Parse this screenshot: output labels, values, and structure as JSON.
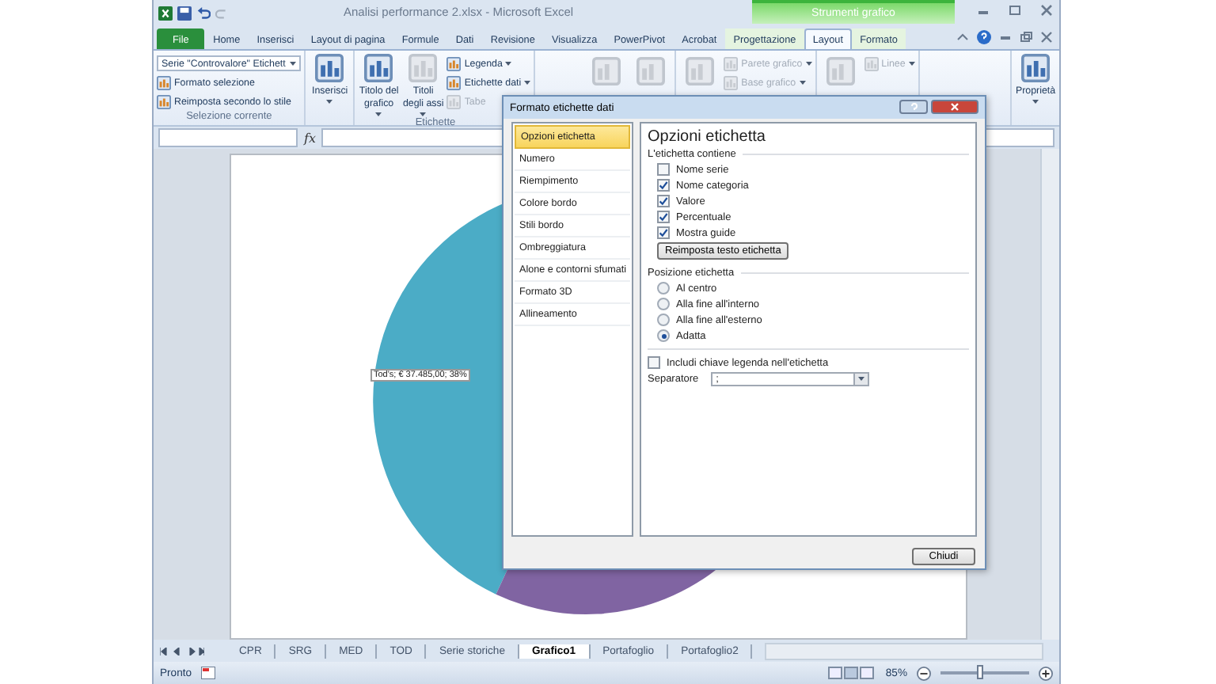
{
  "window": {
    "title": "Analisi performance 2.xlsx  -  Microsoft Excel",
    "context_group": "Strumenti grafico"
  },
  "ribbon_tabs": [
    {
      "label": "File",
      "kind": "file",
      "selected": false
    },
    {
      "label": "Home",
      "kind": "normal",
      "selected": false
    },
    {
      "label": "Inserisci",
      "kind": "normal",
      "selected": false
    },
    {
      "label": "Layout di pagina",
      "kind": "normal",
      "selected": false
    },
    {
      "label": "Formule",
      "kind": "normal",
      "selected": false
    },
    {
      "label": "Dati",
      "kind": "normal",
      "selected": false
    },
    {
      "label": "Revisione",
      "kind": "normal",
      "selected": false
    },
    {
      "label": "Visualizza",
      "kind": "normal",
      "selected": false
    },
    {
      "label": "PowerPivot",
      "kind": "normal",
      "selected": false
    },
    {
      "label": "Acrobat",
      "kind": "normal",
      "selected": false
    },
    {
      "label": "Progettazione",
      "kind": "context",
      "selected": false
    },
    {
      "label": "Layout",
      "kind": "context",
      "selected": true
    },
    {
      "label": "Formato",
      "kind": "context",
      "selected": false
    }
  ],
  "ribbon_groups": [
    {
      "label": "Selezione corrente",
      "items": [
        {
          "kind": "column",
          "items": [
            {
              "kind": "dropdown",
              "label": "Serie \"Controvalore\" Etichett"
            },
            {
              "kind": "small",
              "label": "Formato selezione",
              "disabled": false,
              "menu": false
            },
            {
              "kind": "small",
              "label": "Reimposta secondo lo stile",
              "disabled": false,
              "menu": false
            }
          ]
        }
      ]
    },
    {
      "items": [
        {
          "kind": "large",
          "label": "Inserisci",
          "disabled": false,
          "menu": true
        }
      ]
    },
    {
      "label": "Etichette",
      "items": [
        {
          "kind": "large",
          "label": "Titolo del grafico",
          "disabled": false,
          "menu": true
        },
        {
          "kind": "large",
          "label": "Titoli degli assi",
          "disabled": true,
          "menu": true
        },
        {
          "kind": "column",
          "items": [
            {
              "kind": "small",
              "label": "Legenda",
              "disabled": false,
              "menu": true
            },
            {
              "kind": "small",
              "label": "Etichette dati",
              "disabled": false,
              "menu": true
            },
            {
              "kind": "small",
              "label": "Tabe",
              "disabled": true,
              "menu": false
            }
          ]
        }
      ]
    },
    {
      "items": [
        {
          "kind": "icon",
          "disabled": true
        },
        {
          "kind": "icon",
          "disabled": true
        }
      ]
    },
    {
      "items": [
        {
          "kind": "icon",
          "disabled": true
        },
        {
          "kind": "column",
          "items": [
            {
              "kind": "small",
              "label": "Parete grafico",
              "disabled": true,
              "menu": true
            },
            {
              "kind": "small",
              "label": "Base grafico",
              "disabled": true,
              "menu": true
            }
          ]
        }
      ]
    },
    {
      "items": [
        {
          "kind": "icon",
          "disabled": true
        },
        {
          "kind": "column",
          "items": [
            {
              "kind": "small",
              "label": "Linee",
              "disabled": true,
              "menu": true
            }
          ]
        }
      ]
    },
    {
      "items": [
        {
          "kind": "large",
          "label": "Proprietà",
          "disabled": false,
          "menu": true
        }
      ]
    }
  ],
  "chart": {
    "data_label": "Tod's; € 37.485,00; 38%"
  },
  "dialog": {
    "title": "Formato etichette dati",
    "nav": [
      {
        "label": "Opzioni etichetta",
        "selected": true
      },
      {
        "label": "Numero",
        "selected": false
      },
      {
        "label": "Riempimento",
        "selected": false
      },
      {
        "label": "Colore bordo",
        "selected": false
      },
      {
        "label": "Stili bordo",
        "selected": false
      },
      {
        "label": "Ombreggiatura",
        "selected": false
      },
      {
        "label": "Alone e contorni sfumati",
        "selected": false
      },
      {
        "label": "Formato 3D",
        "selected": false
      },
      {
        "label": "Allineamento",
        "selected": false
      }
    ],
    "heading": "Opzioni etichetta",
    "contains_label": "L'etichetta contiene",
    "contains": [
      {
        "label": "Nome serie",
        "checked": false
      },
      {
        "label": "Nome categoria",
        "checked": true
      },
      {
        "label": "Valore",
        "checked": true
      },
      {
        "label": "Percentuale",
        "checked": true
      },
      {
        "label": "Mostra guide",
        "checked": true
      }
    ],
    "reset_button": "Reimposta testo etichetta",
    "position_label": "Posizione etichetta",
    "positions": [
      {
        "label": "Al centro",
        "selected": false
      },
      {
        "label": "Alla fine all'interno",
        "selected": false
      },
      {
        "label": "Alla fine all'esterno",
        "selected": false
      },
      {
        "label": "Adatta",
        "selected": true
      }
    ],
    "legend_key": {
      "label": "Includi chiave legenda nell'etichetta",
      "checked": false
    },
    "separator": {
      "label": "Separatore",
      "value": ";"
    },
    "close_button": "Chiudi"
  },
  "sheet_tabs": [
    {
      "label": "CPR",
      "selected": false
    },
    {
      "label": "SRG",
      "selected": false
    },
    {
      "label": "MED",
      "selected": false
    },
    {
      "label": "TOD",
      "selected": false
    },
    {
      "label": "Serie storiche",
      "selected": false
    },
    {
      "label": "Grafico1",
      "selected": true
    },
    {
      "label": "Portafoglio",
      "selected": false
    },
    {
      "label": "Portafoglio2",
      "selected": false
    }
  ],
  "formula_bar": {
    "function_label": "fx"
  },
  "status_bar": {
    "status": "Pronto",
    "zoom": "85%",
    "zoom_slider": {
      "level": 0.45
    }
  }
}
